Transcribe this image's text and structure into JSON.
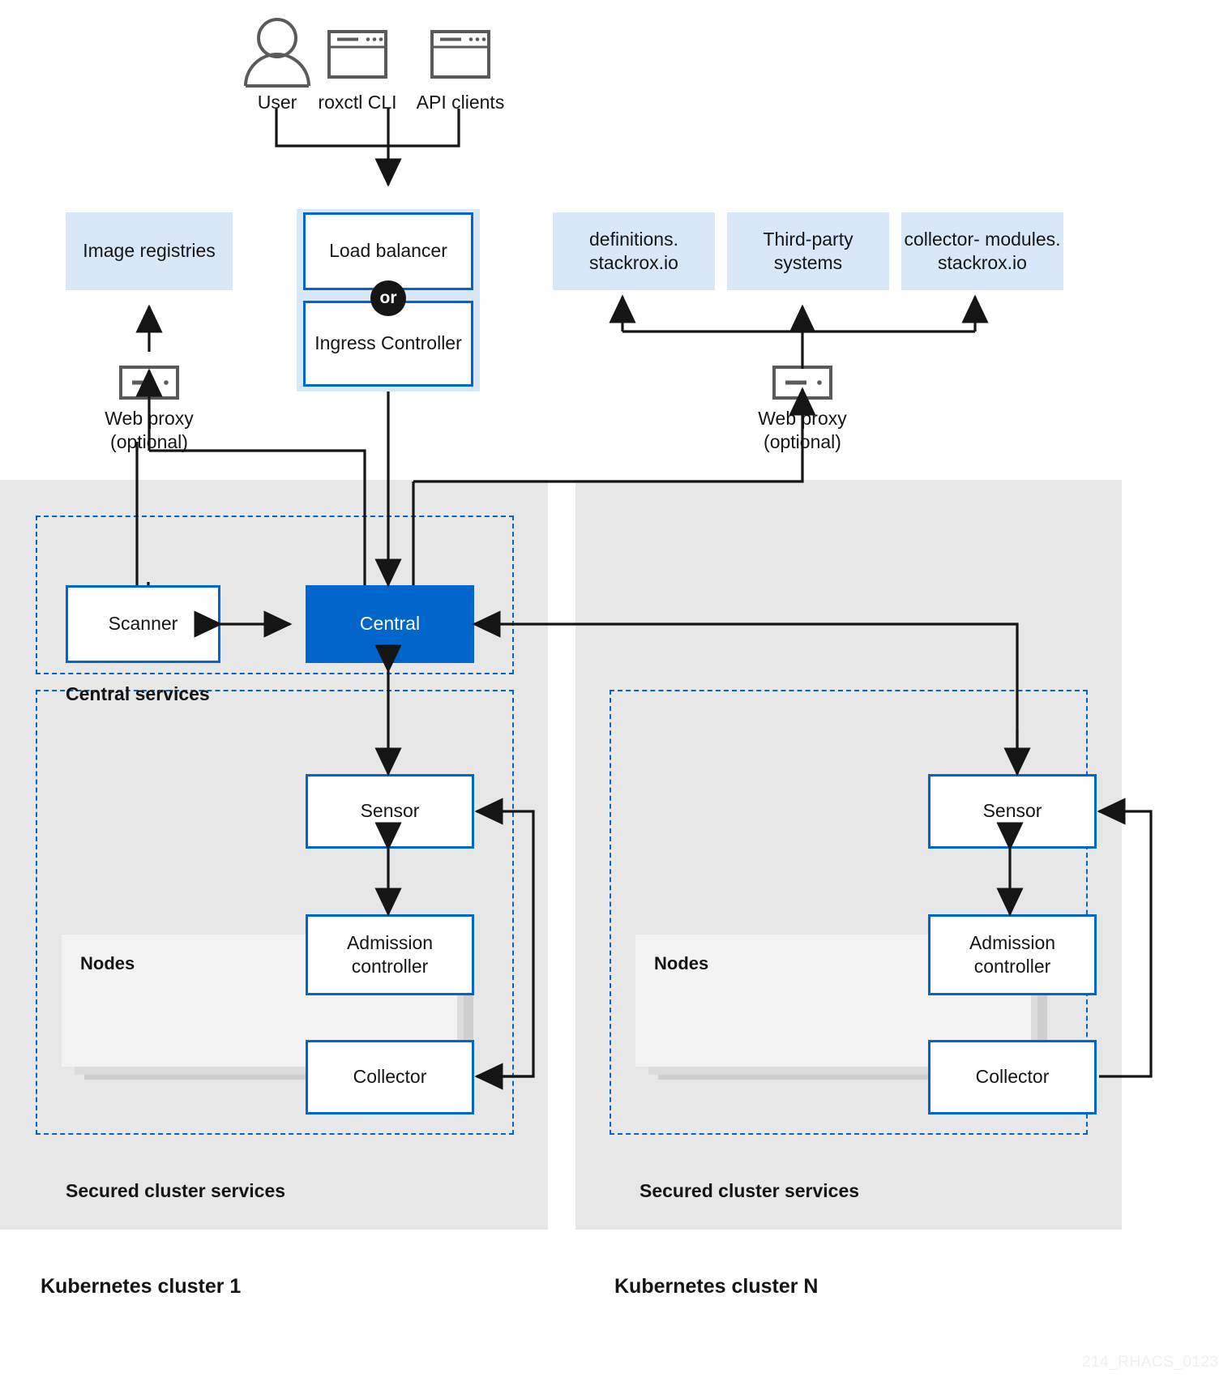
{
  "diagram": {
    "watermark": "214_RHACS_0123",
    "colors": {
      "accent_blue": "#0066cc",
      "external_fill": "#d9e8f8",
      "zone_gray": "#e7e7e7",
      "nodes_gray": "#f3f3f3",
      "line": "#151515"
    }
  },
  "clients": {
    "user": {
      "label": "User",
      "icon": "user-icon"
    },
    "roxctl": {
      "label": "roxctl CLI",
      "icon": "terminal-window-icon"
    },
    "api": {
      "label": "API clients",
      "icon": "terminal-window-icon"
    }
  },
  "entry": {
    "load_balancer": "Load\nbalancer",
    "or_badge": "or",
    "ingress_controller": "Ingress\nController"
  },
  "external": {
    "image_registries": "Image\nregistries",
    "definitions": "definitions.\nstackrox.io",
    "third_party": "Third-party\nsystems",
    "collector_modules": "collector-\nmodules.\nstackrox.io"
  },
  "proxies": {
    "left": {
      "label": "Web proxy\n(optional)",
      "icon": "server-proxy-icon"
    },
    "right": {
      "label": "Web proxy\n(optional)",
      "icon": "server-proxy-icon"
    }
  },
  "central_services": {
    "section_label": "Central services",
    "scanner": "Scanner",
    "central": "Central"
  },
  "clusters": [
    {
      "title": "Kubernetes cluster 1",
      "section_label": "Secured cluster services",
      "sensor": "Sensor",
      "admission_controller": "Admission\ncontroller",
      "nodes_label": "Nodes",
      "collector": "Collector"
    },
    {
      "title": "Kubernetes cluster N",
      "section_label": "Secured cluster services",
      "sensor": "Sensor",
      "admission_controller": "Admission\ncontroller",
      "nodes_label": "Nodes",
      "collector": "Collector"
    }
  ]
}
